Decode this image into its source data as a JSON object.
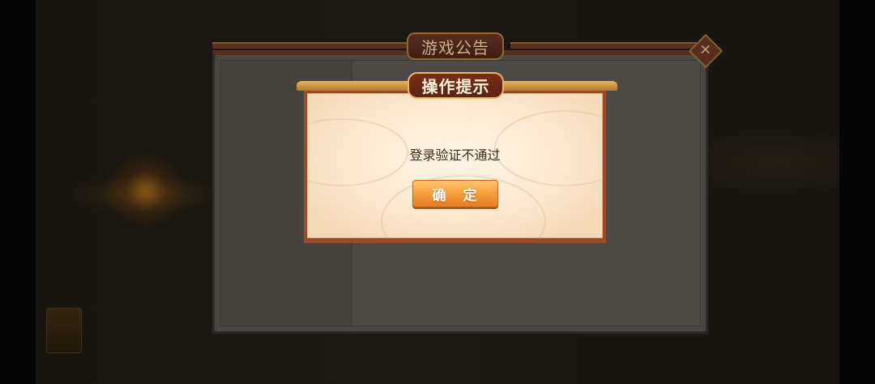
{
  "announcement": {
    "title": "游戏公告"
  },
  "dialog": {
    "title": "操作提示",
    "message": "登录验证不通过",
    "confirm_label": "确　定"
  },
  "icons": {
    "close": "close-icon"
  },
  "colors": {
    "dialog_frame": "#9a4a2a",
    "dialog_bg": "#fbead2",
    "button_orange": "#f59a3a",
    "title_plate": "#7a2f19"
  }
}
